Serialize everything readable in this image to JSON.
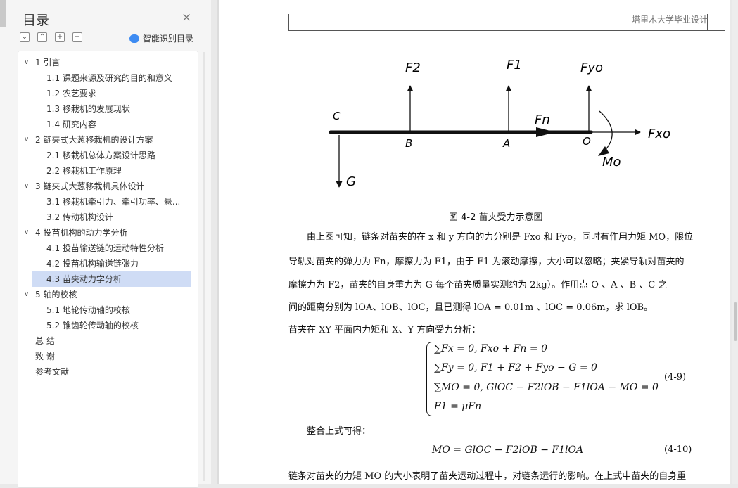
{
  "sidebar": {
    "title": "目录",
    "close_icon": "×",
    "tools": [
      "⌄",
      "⌃",
      "+",
      "−"
    ],
    "smart_toc_label": "智能识别目录",
    "items": [
      {
        "label": "1 引言",
        "level": 1,
        "expanded": true
      },
      {
        "label": "1.1 课题来源及研究的目的和意义",
        "level": 2
      },
      {
        "label": "1.2 农艺要求",
        "level": 2
      },
      {
        "label": "1.3 移栽机的发展现状",
        "level": 2
      },
      {
        "label": "1.4 研究内容",
        "level": 2
      },
      {
        "label": "2 链夹式大葱移栽机的设计方案",
        "level": 1,
        "expanded": true
      },
      {
        "label": "2.1 移栽机总体方案设计思路",
        "level": 2
      },
      {
        "label": "2.2 移栽机工作原理",
        "level": 2
      },
      {
        "label": "3 链夹式大葱移栽机具体设计",
        "level": 1,
        "expanded": true
      },
      {
        "label": "3.1 移栽机牵引力、牵引功率、悬...",
        "level": 2
      },
      {
        "label": "3.2 传动机构设计",
        "level": 2
      },
      {
        "label": "4 投苗机构的动力学分析",
        "level": 1,
        "expanded": true
      },
      {
        "label": "4.1 投苗输送链的运动特性分析",
        "level": 2
      },
      {
        "label": "4.2 投苗机构输送链张力",
        "level": 2
      },
      {
        "label": "4.3 苗夹动力学分析",
        "level": 2,
        "active": true
      },
      {
        "label": "5 轴的校核",
        "level": 1,
        "expanded": true
      },
      {
        "label": "5.1 地轮传动轴的校核",
        "level": 2
      },
      {
        "label": "5.2 锥齿轮传动轴的校核",
        "level": 2
      },
      {
        "label": "总  结",
        "level": 1
      },
      {
        "label": "致  谢",
        "level": 1
      },
      {
        "label": "参考文献",
        "level": 1
      }
    ]
  },
  "document": {
    "header": "塔里木大学毕业设计",
    "figure": {
      "labels": {
        "f2": "F2",
        "f1": "F1",
        "fyo": "Fyo",
        "fn": "Fn",
        "fxo": "Fxo",
        "mo": "Mo",
        "g": "G",
        "c": "C",
        "b": "B",
        "a": "A",
        "o": "O"
      },
      "caption": "图 4-2 苗夹受力示意图"
    },
    "paragraphs": [
      "由上图可知，链条对苗夹的在 x 和 y 方向的力分别是 Fxo 和 Fyo，同时有作用力矩 MO，限位",
      "导轨对苗夹的弹力为 Fn，摩擦力为 F1，由于  F1 为滚动摩擦，大小可以忽略；夹紧导轨对苗夹的",
      "摩擦力为  F2，苗夹的自身重力为  G 每个苗夹质量实测约为 2kg）。作用点  O 、A 、B 、C  之",
      "间的距离分别为  lOA、lOB、lOC，且已测得 lOA = 0.01m 、lOC = 0.06m，求  lOB。",
      "苗夹在  XY 平面内力矩和 X、Y 方向受力分析："
    ],
    "equations_49": [
      "∑Fx = 0, Fxo + Fn = 0",
      "∑Fy = 0, F1 + F2 + Fyo − G = 0",
      "∑MO = 0, GlOC − F2lOB − F1lOA − MO = 0",
      "F1 = μFn"
    ],
    "eq_49_number": "(4-9)",
    "merge_text": "整合上式可得：",
    "equation_410": "MO = GlOC − F2lOB − F1lOA",
    "eq_410_number": "(4-10)",
    "last_paragraph": "链条对苗夹的力矩 MO 的大小表明了苗夹运动过程中，对链条运行的影响。在上式中苗夹的自身重"
  }
}
